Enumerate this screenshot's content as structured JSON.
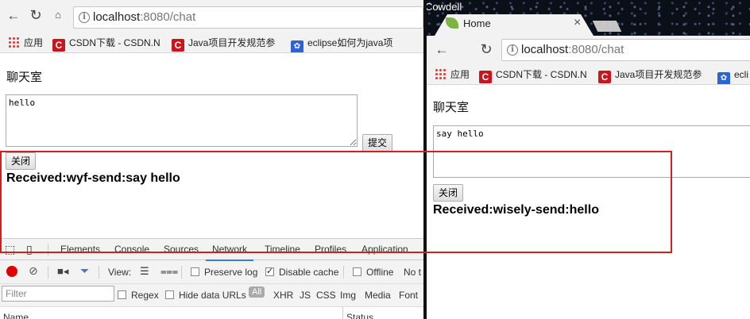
{
  "left_window": {
    "url_host": "localhost",
    "url_path": ":8080/chat",
    "bookmarks": [
      {
        "label": "应用",
        "icon": "apps-grid-icon"
      },
      {
        "label": "CSDN下载 - CSDN.N",
        "icon": "csdn-c-icon"
      },
      {
        "label": "Java项目开发规范参",
        "icon": "csdn-c-icon"
      },
      {
        "label": "eclipse如何为java项",
        "icon": "paw-icon"
      }
    ],
    "page_title": "聊天室",
    "textarea_value": "hello",
    "submit_label": "提交",
    "close_label": "关闭",
    "received_text": "Received:wyf-send:say hello"
  },
  "devtools": {
    "tabs": [
      "Elements",
      "Console",
      "Sources",
      "Network",
      "Timeline",
      "Profiles",
      "Application"
    ],
    "active_tab": "Network",
    "view_label": "View:",
    "preserve_log": "Preserve log",
    "disable_cache": "Disable cache",
    "offline": "Offline",
    "no_throttling": "No t",
    "filter_placeholder": "Filter",
    "regex": "Regex",
    "hide_data_urls": "Hide data URLs",
    "all_label": "All",
    "types": [
      "XHR",
      "JS",
      "CSS",
      "Img",
      "Media",
      "Font"
    ],
    "col_name": "Name",
    "col_status": "Status"
  },
  "right_window": {
    "profile_name": "Cowdell",
    "tab_title": "Home",
    "tab_close": "×",
    "url_host": "localhost",
    "url_path": ":8080/chat",
    "bookmarks": [
      {
        "label": "应用",
        "icon": "apps-grid-icon"
      },
      {
        "label": "CSDN下载 - CSDN.N",
        "icon": "csdn-c-icon"
      },
      {
        "label": "Java项目开发规范参",
        "icon": "csdn-c-icon"
      },
      {
        "label": "ecli",
        "icon": "paw-icon"
      }
    ],
    "page_title": "聊天室",
    "textarea_value": "say hello",
    "close_label": "关闭",
    "received_text": "Received:wisely-send:hello"
  },
  "colors": {
    "highlight": "#d21f1f",
    "devtools_accent": "#3879d9",
    "record_red": "#e00000"
  }
}
